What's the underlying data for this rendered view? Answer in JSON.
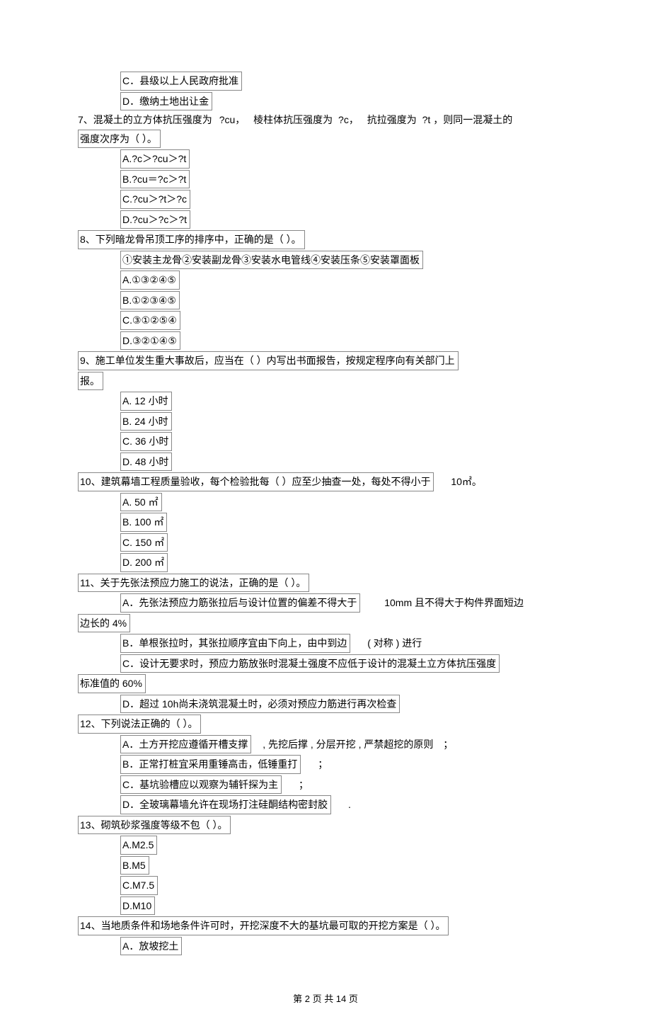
{
  "q6": {
    "options": {
      "c": "C．县级以上人民政府批准",
      "d": "D．缴纳土地出让金"
    }
  },
  "q7": {
    "stem_a": "7、混凝土的立方体抗压强度为",
    "stem_b": "?cu，",
    "stem_c": "棱柱体抗压强度为",
    "stem_d": "?c，",
    "stem_e": "抗拉强度为",
    "stem_f": "?t ，则同一混凝土的",
    "stem_g": "强度次序为（            ）。",
    "options": {
      "a": "A.?c＞?cu＞?t",
      "b": "B.?cu＝?c＞?t",
      "c": "C.?cu＞?t＞?c",
      "d": "D.?cu＞?c＞?t"
    }
  },
  "q8": {
    "stem": "8、下列暗龙骨吊顶工序的排序中，正确的是（            ）。",
    "sub": "①安装主龙骨②安装副龙骨③安装水电管线④安装压条⑤安装罩面板",
    "options": {
      "a": "A.①③②④⑤",
      "b": "B.①②③④⑤",
      "c": "C.③①②⑤④",
      "d": "D.③②①④⑤"
    }
  },
  "q9": {
    "stem_a": "9、施工单位发生重大事故后，应当在（            ）内写出书面报告，按规定程序向有关部门上",
    "stem_b": "报。",
    "options": {
      "a": "A. 12  小时",
      "b": "B. 24  小时",
      "c": "C. 36  小时",
      "d": "D. 48  小时"
    }
  },
  "q10": {
    "stem_a": "10、建筑幕墙工程质量验收，每个检验批每（            ）应至少抽查一处，每处不得小于",
    "stem_b": "10㎡。",
    "options": {
      "a": "A. 50 ㎡",
      "b": "B. 100 ㎡",
      "c": "C. 150 ㎡",
      "d": "D. 200 ㎡"
    }
  },
  "q11": {
    "stem": "11、关于先张法预应力施工的说法，正确的是（            ）。",
    "opt_a_a": "A．先张法预应力筋张拉后与设计位置的偏差不得大于",
    "opt_a_b": "10mm 且不得大于构件界面短边",
    "opt_a_c": "边长的 4%",
    "opt_b_a": "B．单根张拉时，其张拉顺序宜由下向上，由中到边",
    "opt_b_b": "( 对称 ) 进行",
    "opt_c": "C．设计无要求时，预应力筋放张时混凝土强度不应低于设计的混凝土立方体抗压强度",
    "opt_c_b": "标准值的 60%",
    "opt_d": "D．超过 10h尚未浇筑混凝土时，必须对预应力筋进行再次检查"
  },
  "q12": {
    "stem": "12、下列说法正确的（            ）。",
    "opt_a_a": "A．土方开挖应遵循开槽支撑",
    "opt_a_b": ", 先挖后撑 , 分层开挖 , 严禁超挖的原则",
    "opt_a_c": "；",
    "opt_b_a": "B．正常打桩宜采用重锤高击，低锤重打",
    "opt_b_b": "；",
    "opt_c_a": "C．基坑验槽应以观察为辅钎探为主",
    "opt_c_b": "；",
    "opt_d_a": "D．全玻璃幕墙允许在现场打注硅酮结构密封胶",
    "opt_d_b": "."
  },
  "q13": {
    "stem": "13、砌筑砂浆强度等级不包（            ）。",
    "options": {
      "a": "A.M2.5",
      "b": "B.M5",
      "c": "C.M7.5",
      "d": "D.M10"
    }
  },
  "q14": {
    "stem": "14、当地质条件和场地条件许可时，开挖深度不大的基坑最可取的开挖方案是（            ）。",
    "opt_a": "A．放坡挖土"
  },
  "footer": "第 2 页 共 14 页"
}
